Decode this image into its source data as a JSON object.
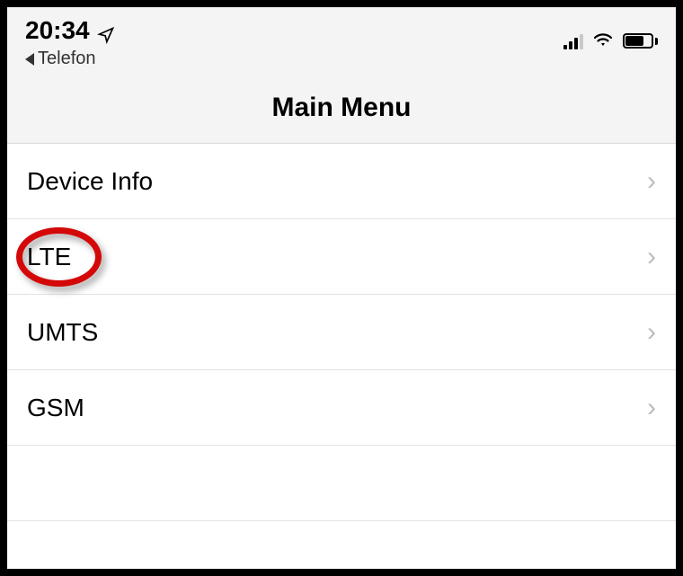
{
  "status": {
    "time": "20:34",
    "back_app": "Telefon"
  },
  "header": {
    "title": "Main Menu"
  },
  "menu": {
    "items": [
      {
        "label": "Device Info",
        "highlighted": false
      },
      {
        "label": "LTE",
        "highlighted": true
      },
      {
        "label": "UMTS",
        "highlighted": false
      },
      {
        "label": "GSM",
        "highlighted": false
      }
    ]
  }
}
